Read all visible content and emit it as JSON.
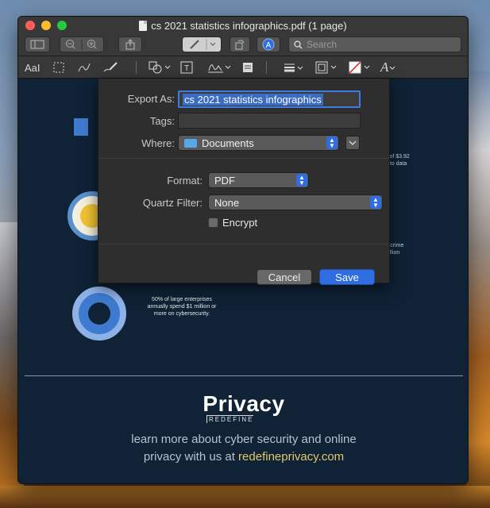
{
  "window": {
    "title": "cs 2021 statistics infographics.pdf (1 page)"
  },
  "toolbar": {
    "search_placeholder": "Search"
  },
  "markup": {
    "text_tool_label": "AaI",
    "font_tool_label": "A"
  },
  "document": {
    "stat_cost_lines": [
      "s of $3.92",
      "e to data"
    ],
    "stat_crime_lines": [
      "ercrime",
      "trillion"
    ],
    "stat_enterprise_lines": [
      "50% of large enterprises",
      "annually spend $1 million or",
      "more on cybersecurity."
    ],
    "logo_text": "Privacy",
    "logo_subtext": "REDEFINE",
    "footer_line1": "learn more about cyber security and online",
    "footer_line2_prefix": "privacy with us at ",
    "footer_link": "redefineprivacy.com"
  },
  "export_sheet": {
    "export_as_label": "Export As:",
    "export_as_value": "cs 2021 statistics infographics",
    "tags_label": "Tags:",
    "tags_value": "",
    "where_label": "Where:",
    "where_value": "Documents",
    "format_label": "Format:",
    "format_value": "PDF",
    "quartz_label": "Quartz Filter:",
    "quartz_value": "None",
    "encrypt_label": "Encrypt",
    "encrypt_checked": false,
    "cancel_label": "Cancel",
    "save_label": "Save"
  },
  "colors": {
    "accent": "#2f6de0",
    "doc_background": "#0f2236",
    "link": "#e2c86a"
  }
}
